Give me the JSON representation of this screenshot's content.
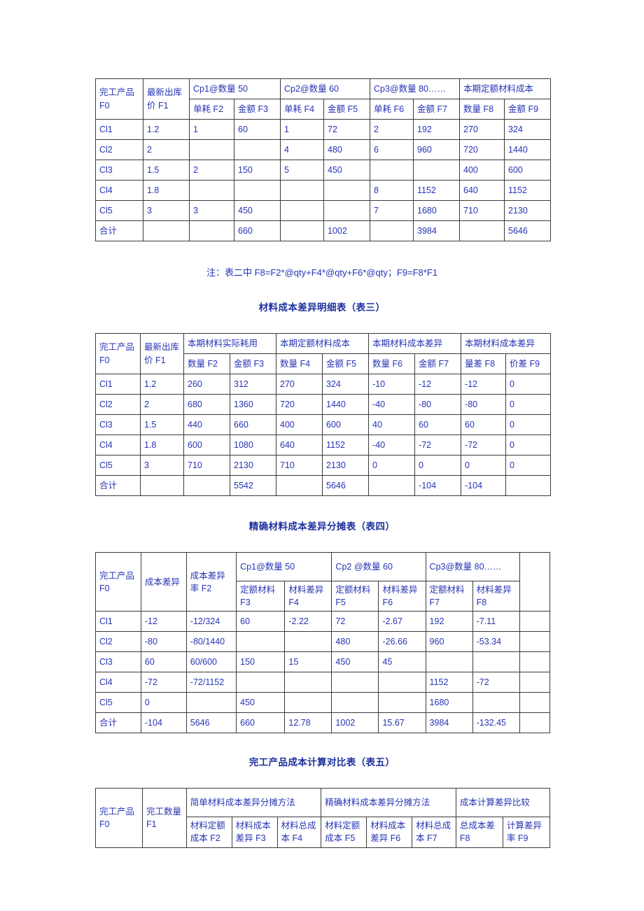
{
  "document": {
    "text_color": "#2734b4",
    "title_color": "#1c2f9e",
    "border_color": "#3a3a3a"
  },
  "table2": {
    "header_top": {
      "col0": "完工产品 F0",
      "col1": "最新出库价 F1",
      "group1": "Cp1@数量 50",
      "group2": "Cp2@数量 60",
      "group3": "Cp3@数量 80……",
      "group4": "本期定额材料成本"
    },
    "header_sub": [
      "单耗 F2",
      "金额 F3",
      "单耗 F4",
      "金额 F5",
      "单耗 F6",
      "金额 F7",
      "数量 F8",
      "金额 F9"
    ],
    "rows": [
      [
        "Cl1",
        "1.2",
        "1",
        "60",
        "1",
        "72",
        "2",
        "192",
        "270",
        "324"
      ],
      [
        "Cl2",
        "2",
        "",
        "",
        "4",
        "480",
        "6",
        "960",
        "720",
        "1440"
      ],
      [
        "Cl3",
        "1.5",
        "2",
        "150",
        "5",
        "450",
        "",
        "",
        "400",
        "600"
      ],
      [
        "Cl4",
        "1.8",
        "",
        "",
        "",
        "",
        "8",
        "1152",
        "640",
        "1152"
      ],
      [
        "Cl5",
        "3",
        "3",
        "450",
        "",
        "",
        "7",
        "1680",
        "710",
        "2130"
      ],
      [
        "合计",
        "",
        "",
        "660",
        "",
        "1002",
        "",
        "3984",
        "",
        "5646"
      ]
    ]
  },
  "note": "注：表二中 F8=F2*@qty+F4*@qty+F6*@qty；F9=F8*F1",
  "table3": {
    "title": "材料成本差异明细表（表三）",
    "header_top": {
      "col0": "完工产品 F0",
      "col1": "最新出库价 F1",
      "group1": "本期材料实际耗用",
      "group2": "本期定额材料成本",
      "group3": "本期材料成本差异",
      "group4": "本期材料成本差异"
    },
    "header_sub": [
      "数量 F2",
      "金额 F3",
      "数量 F4",
      "金额 F5",
      "数量 F6",
      "金额 F7",
      "量差 F8",
      "价差 F9"
    ],
    "rows": [
      [
        "Cl1",
        "1.2",
        "260",
        "312",
        "270",
        "324",
        "-10",
        "-12",
        "-12",
        "0"
      ],
      [
        "Cl2",
        "2",
        "680",
        "1360",
        "720",
        "1440",
        "-40",
        "-80",
        "-80",
        "0"
      ],
      [
        "Cl3",
        "1.5",
        "440",
        "660",
        "400",
        "600",
        "40",
        "60",
        "60",
        "0"
      ],
      [
        "Cl4",
        "1.8",
        "600",
        "1080",
        "640",
        "1152",
        "-40",
        "-72",
        "-72",
        "0"
      ],
      [
        "Cl5",
        "3",
        "710",
        "2130",
        "710",
        "2130",
        "0",
        "0",
        "0",
        "0"
      ],
      [
        "合计",
        "",
        "",
        "5542",
        "",
        "5646",
        "",
        "-104",
        "-104",
        ""
      ]
    ]
  },
  "table4": {
    "title": "精确材料成本差异分摊表（表四）",
    "header_top": {
      "col0": "完工产品 F0",
      "col1": "成本差异",
      "col2": "成本差异率 F2",
      "group1": "Cp1@数量 50",
      "group2": "Cp2 @数量 60",
      "group3": "Cp3@数量 80……",
      "group4": ""
    },
    "header_sub": [
      "定额材料 F3",
      "材料差异 F4",
      "定额材料 F5",
      "材料差异 F6",
      "定额材料 F7",
      "材料差异 F8",
      ""
    ],
    "rows": [
      [
        "Cl1",
        "-12",
        "-12/324",
        "60",
        "-2.22",
        "72",
        "-2.67",
        "192",
        "-7.11",
        ""
      ],
      [
        "Cl2",
        "-80",
        "-80/1440",
        "",
        "",
        "480",
        "-26.66",
        "960",
        "-53.34",
        ""
      ],
      [
        "Cl3",
        "60",
        "60/600",
        "150",
        "15",
        "450",
        "45",
        "",
        "",
        ""
      ],
      [
        "Cl4",
        "-72",
        "-72/1152",
        "",
        "",
        "",
        "",
        "1152",
        "-72",
        ""
      ],
      [
        "Cl5",
        "0",
        "",
        "450",
        "",
        "",
        "",
        "1680",
        "",
        ""
      ],
      [
        "合计",
        "-104",
        "5646",
        "660",
        "12.78",
        "1002",
        "15.67",
        "3984",
        "-132.45",
        ""
      ]
    ]
  },
  "table5": {
    "title": "完工产品成本计算对比表（表五）",
    "header_top": {
      "col0": "完工产品 F0",
      "col1": "完工数量 F1",
      "group1": "简单材料成本差异分摊方法",
      "group2": "精确材料成本差异分摊方法",
      "group3": "成本计算差异比较"
    },
    "header_sub": [
      "材料定额成本 F2",
      "材料成本差异 F3",
      "材料总成本 F4",
      "材料定额成本 F5",
      "材料成本差异 F6",
      "材料总成本 F7",
      "总成本差 F8",
      "计算差异率 F9"
    ]
  }
}
